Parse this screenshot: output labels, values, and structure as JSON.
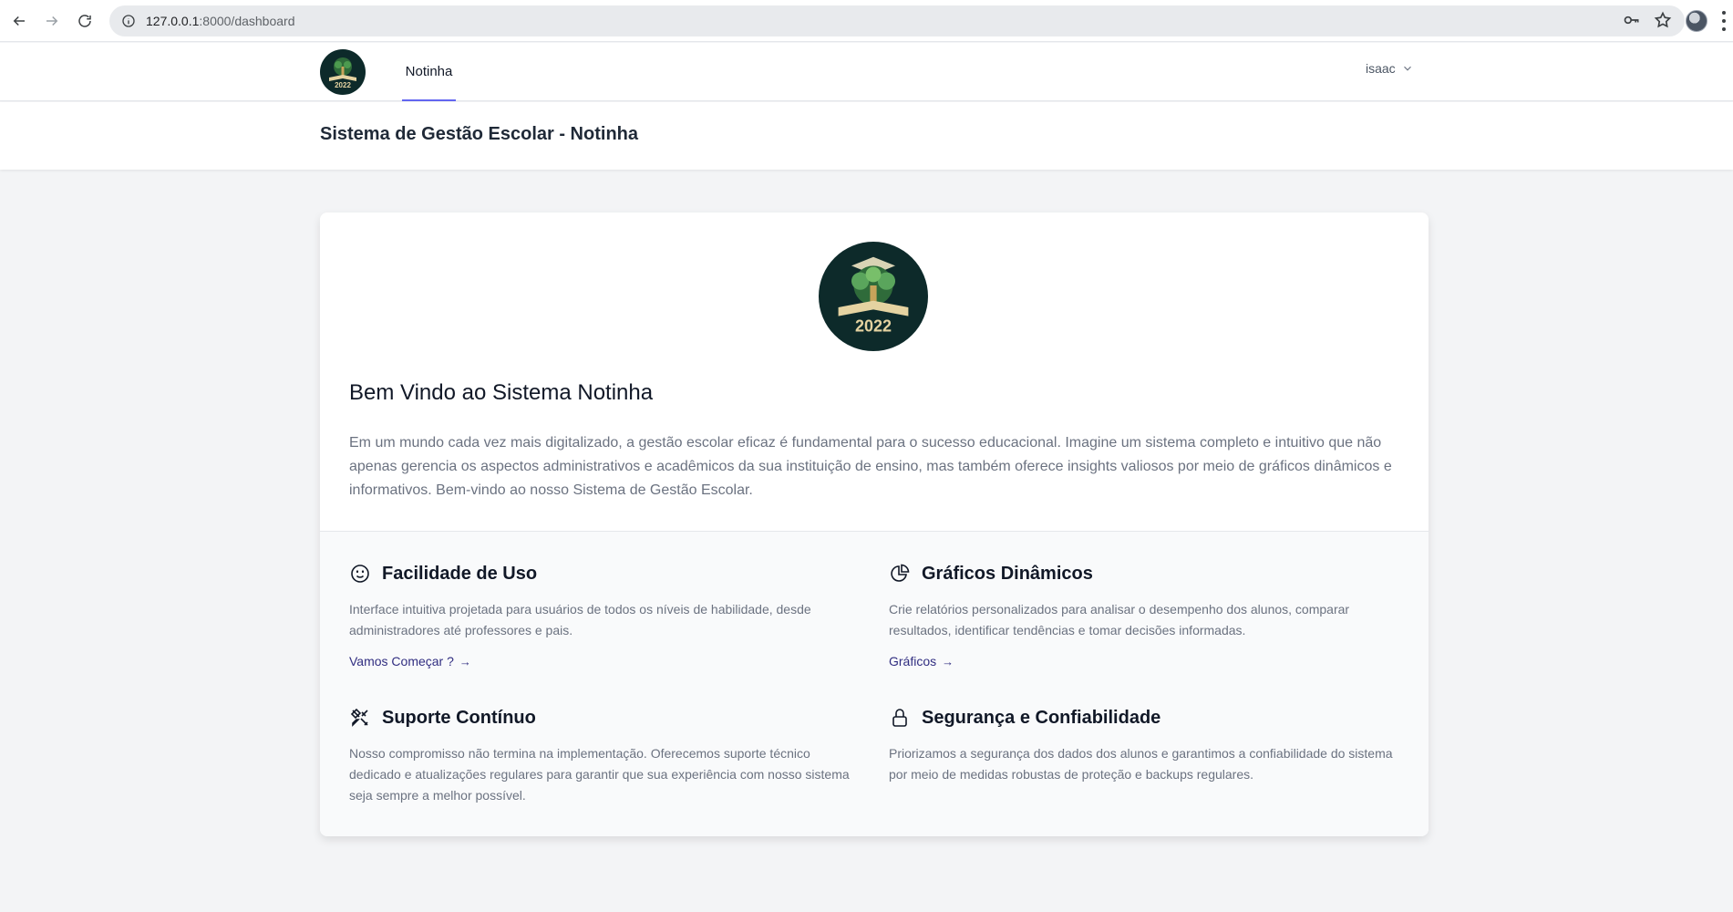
{
  "browser": {
    "url_host": "127.0.0.1",
    "url_rest": ":8000/dashboard"
  },
  "nav": {
    "tab_label": "Notinha",
    "user_name": "isaac"
  },
  "header": {
    "title": "Sistema de Gestão Escolar - Notinha"
  },
  "hero": {
    "logo_text": "2022",
    "title": "Bem Vindo ao Sistema Notinha",
    "intro": "Em um mundo cada vez mais digitalizado, a gestão escolar eficaz é fundamental para o sucesso educacional. Imagine um sistema completo e intuitivo que não apenas gerencia os aspectos administrativos e acadêmicos da sua instituição de ensino, mas também oferece insights valiosos por meio de gráficos dinâmicos e informativos. Bem-vindo ao nosso Sistema de Gestão Escolar."
  },
  "features": [
    {
      "icon": "smiley-icon",
      "title": "Facilidade de Uso",
      "desc": "Interface intuitiva projetada para usuários de todos os níveis de habilidade, desde administradores até professores e pais.",
      "link": "Vamos Começar ?"
    },
    {
      "icon": "pie-chart-icon",
      "title": "Gráficos Dinâmicos",
      "desc": "Crie relatórios personalizados para analisar o desempenho dos alunos, comparar resultados, identificar tendências e tomar decisões informadas.",
      "link": "Gráficos"
    },
    {
      "icon": "tools-icon",
      "title": "Suporte Contínuo",
      "desc": "Nosso compromisso não termina na implementação. Oferecemos suporte técnico dedicado e atualizações regulares para garantir que sua experiência com nosso sistema seja sempre a melhor possível."
    },
    {
      "icon": "lock-icon",
      "title": "Segurança e Confiabilidade",
      "desc": "Priorizamos a segurança dos dados dos alunos e garantimos a confiabilidade do sistema por meio de medidas robustas de proteção e backups regulares."
    }
  ],
  "colors": {
    "accent": "#6366f1",
    "link": "#312e81",
    "logo_bg": "#0d2a2a"
  }
}
